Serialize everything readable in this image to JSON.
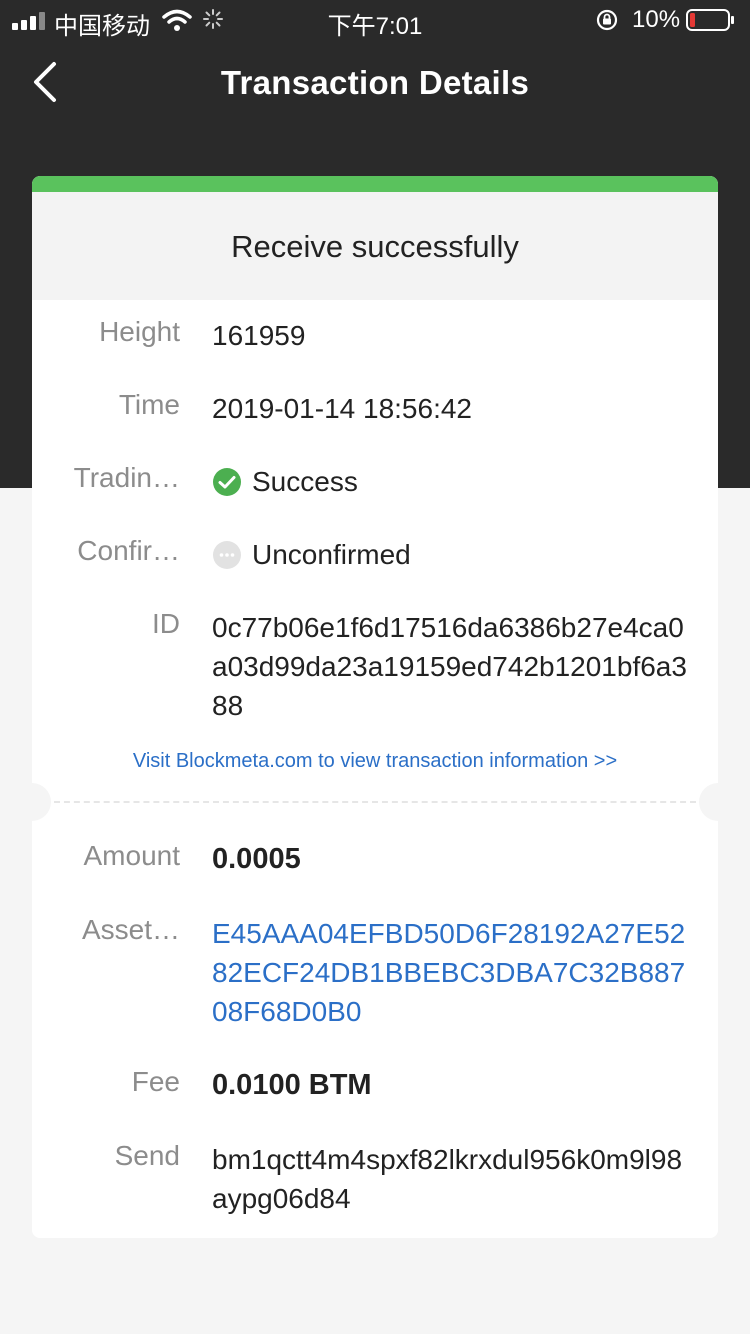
{
  "status_bar": {
    "carrier": "中国移动",
    "time": "下午7:01",
    "battery_percent": "10%"
  },
  "nav": {
    "back_icon": "chevron-left-icon",
    "title": "Transaction Details"
  },
  "card": {
    "status_title": "Receive successfully",
    "accent_color": "#5ac25d",
    "link_color": "#2b6fc7",
    "height": {
      "label": "Height",
      "value": "161959"
    },
    "time": {
      "label": "Time",
      "value": "2019-01-14 18:56:42"
    },
    "trading": {
      "label": "Tradin…",
      "value": "Success",
      "icon": "check-circle-icon"
    },
    "confirm": {
      "label": "Confir…",
      "value": "Unconfirmed",
      "icon": "pending-dots-icon"
    },
    "id": {
      "label": "ID",
      "value": "0c77b06e1f6d17516da6386b27e4ca0a03d99da23a19159ed742b1201bf6a388"
    },
    "visit_link": "Visit Blockmeta.com to view transaction information >>",
    "amount": {
      "label": "Amount",
      "value": "0.0005"
    },
    "asset": {
      "label": "Asset…",
      "value": "E45AAA04EFBD50D6F28192A27E5282ECF24DB1BBEBC3DBA7C32B88708F68D0B0"
    },
    "fee": {
      "label": "Fee",
      "value": "0.0100 BTM"
    },
    "send": {
      "label": "Send",
      "value": "bm1qctt4m4spxf82lkrxdul956k0m9l98aypg06d84"
    }
  }
}
